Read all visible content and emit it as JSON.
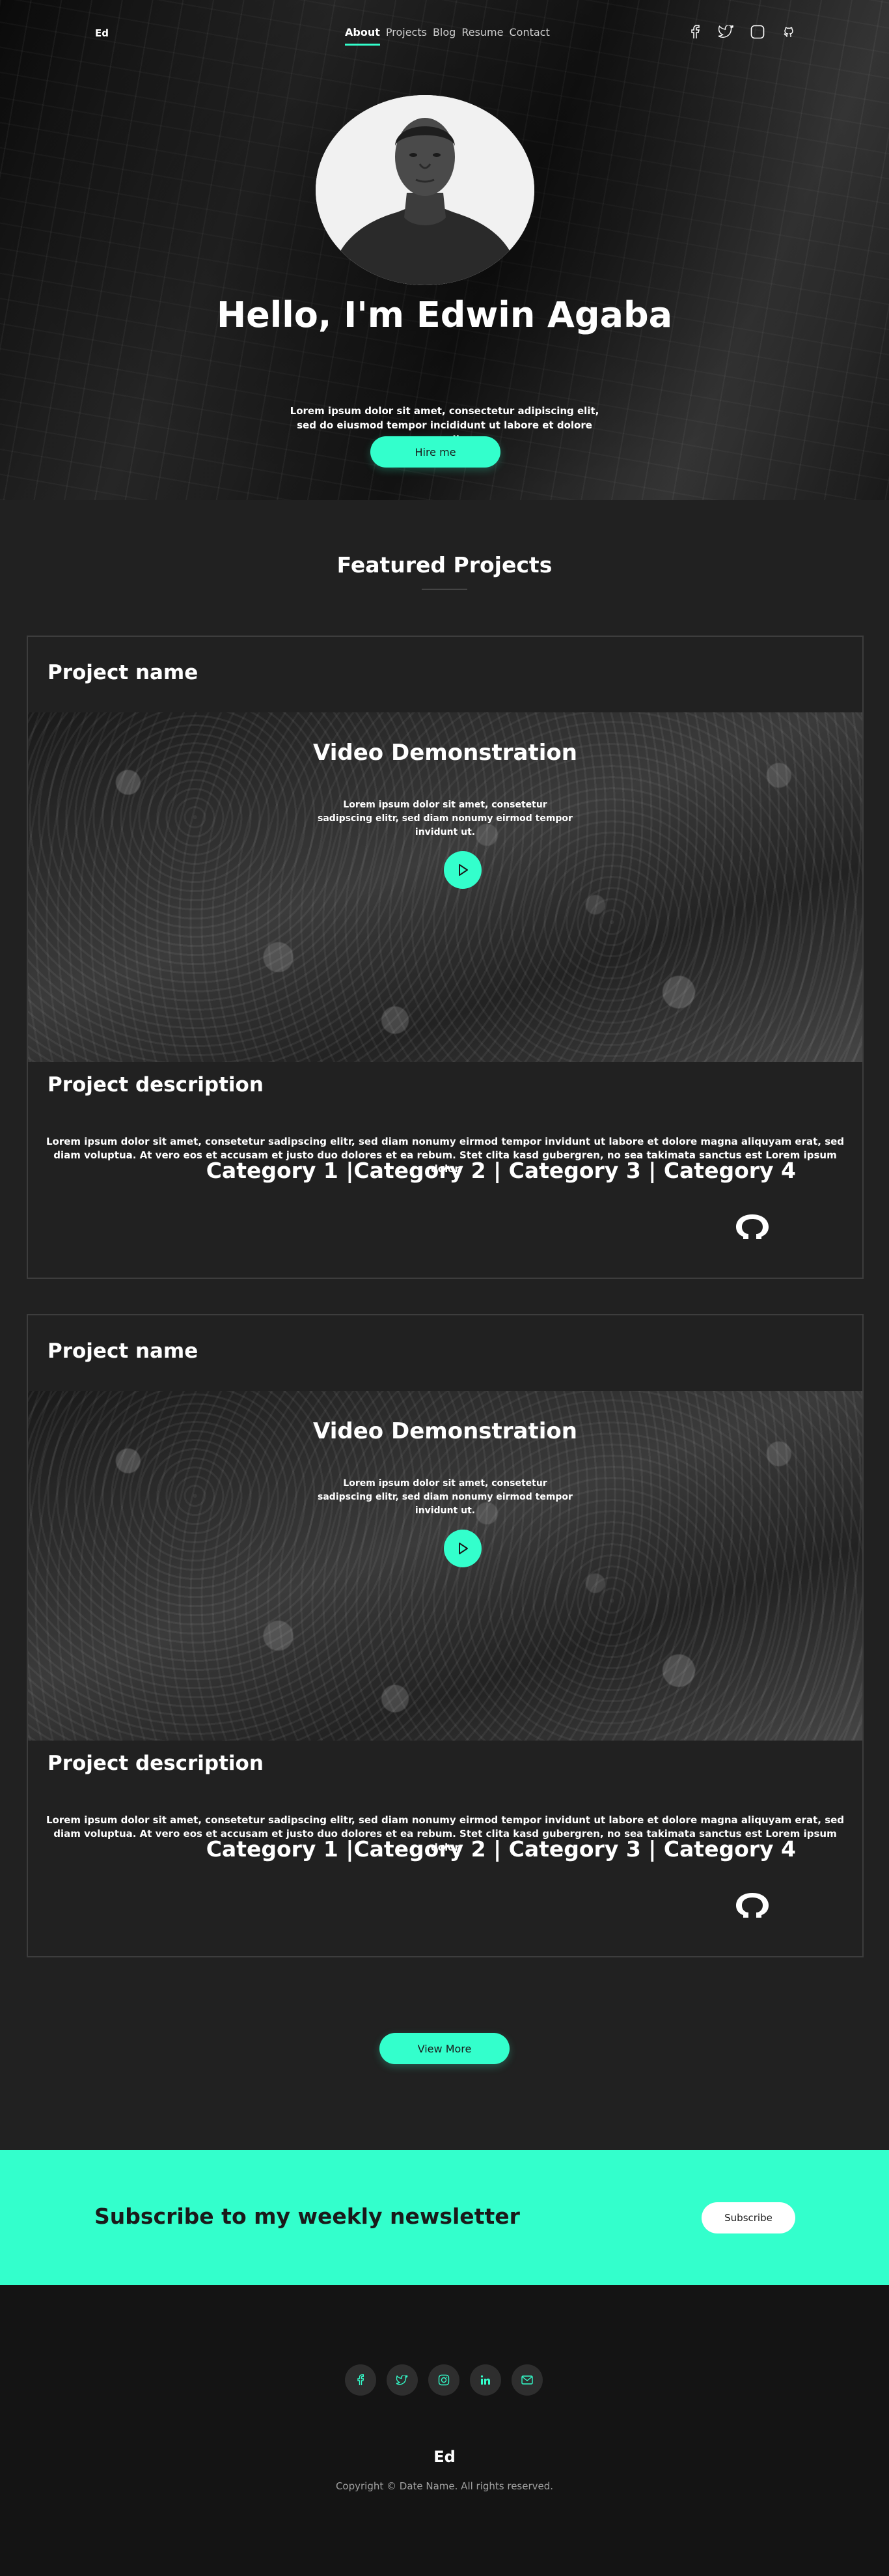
{
  "nav": {
    "brand": "Ed",
    "links": [
      {
        "label": "About",
        "active": true
      },
      {
        "label": "Projects"
      },
      {
        "label": "Blog"
      },
      {
        "label": "Resume"
      },
      {
        "label": "Contact"
      }
    ],
    "icons": [
      "facebook-icon",
      "twitter-icon",
      "instagram-icon",
      "github-icon"
    ]
  },
  "hero": {
    "title": "Hello, I'm Edwin Agaba",
    "text": "Lorem ipsum dolor sit amet, consectetur adipiscing elit, sed do eiusmod tempor incididunt ut labore et dolore magna aliqua.",
    "button": "Hire me"
  },
  "projects": {
    "title": "Featured Projects",
    "items": [
      {
        "name": "Project name",
        "video_title": "Video  Demonstration",
        "video_text": "Lorem ipsum dolor sit amet, consetetur sadipscing elitr, sed diam nonumy eirmod tempor invidunt ut.",
        "desc_title": "Project description",
        "desc_text": "Lorem ipsum dolor sit amet, consetetur sadipscing elitr, sed diam nonumy eirmod tempor invidunt ut labore et dolore magna aliquyam erat, sed diam voluptua. At vero eos et accusam et justo duo dolores et ea rebum. Stet clita kasd gubergren, no sea takimata sanctus est Lorem ipsum dolor",
        "categories": "Category 1 |Category 2 | Category 3 | Category 4"
      },
      {
        "name": "Project name",
        "video_title": "Video  Demonstration",
        "video_text": "Lorem ipsum dolor sit amet, consetetur sadipscing elitr, sed diam nonumy eirmod tempor invidunt ut.",
        "desc_title": "Project description",
        "desc_text": "Lorem ipsum dolor sit amet, consetetur sadipscing elitr, sed diam nonumy eirmod tempor invidunt ut labore et dolore magna aliquyam erat, sed diam voluptua. At vero eos et accusam et justo duo dolores et ea rebum. Stet clita kasd gubergren, no sea takimata sanctus est Lorem ipsum dolor",
        "categories": "Category 1 |Category 2 | Category 3 | Category 4"
      }
    ],
    "view_more": "View More"
  },
  "newsletter": {
    "title": "Subscribe to my weekly newsletter",
    "button": "Subscribe"
  },
  "footer": {
    "social_icons": [
      "facebook-icon",
      "twitter-icon",
      "instagram-icon",
      "linkedin-icon",
      "mail-icon"
    ],
    "brand": "Ed",
    "copyright": "Copyright © Date Name. All rights reserved."
  },
  "colors": {
    "accent": "#33ffcc",
    "background": "#212121",
    "footer": "#141414"
  }
}
